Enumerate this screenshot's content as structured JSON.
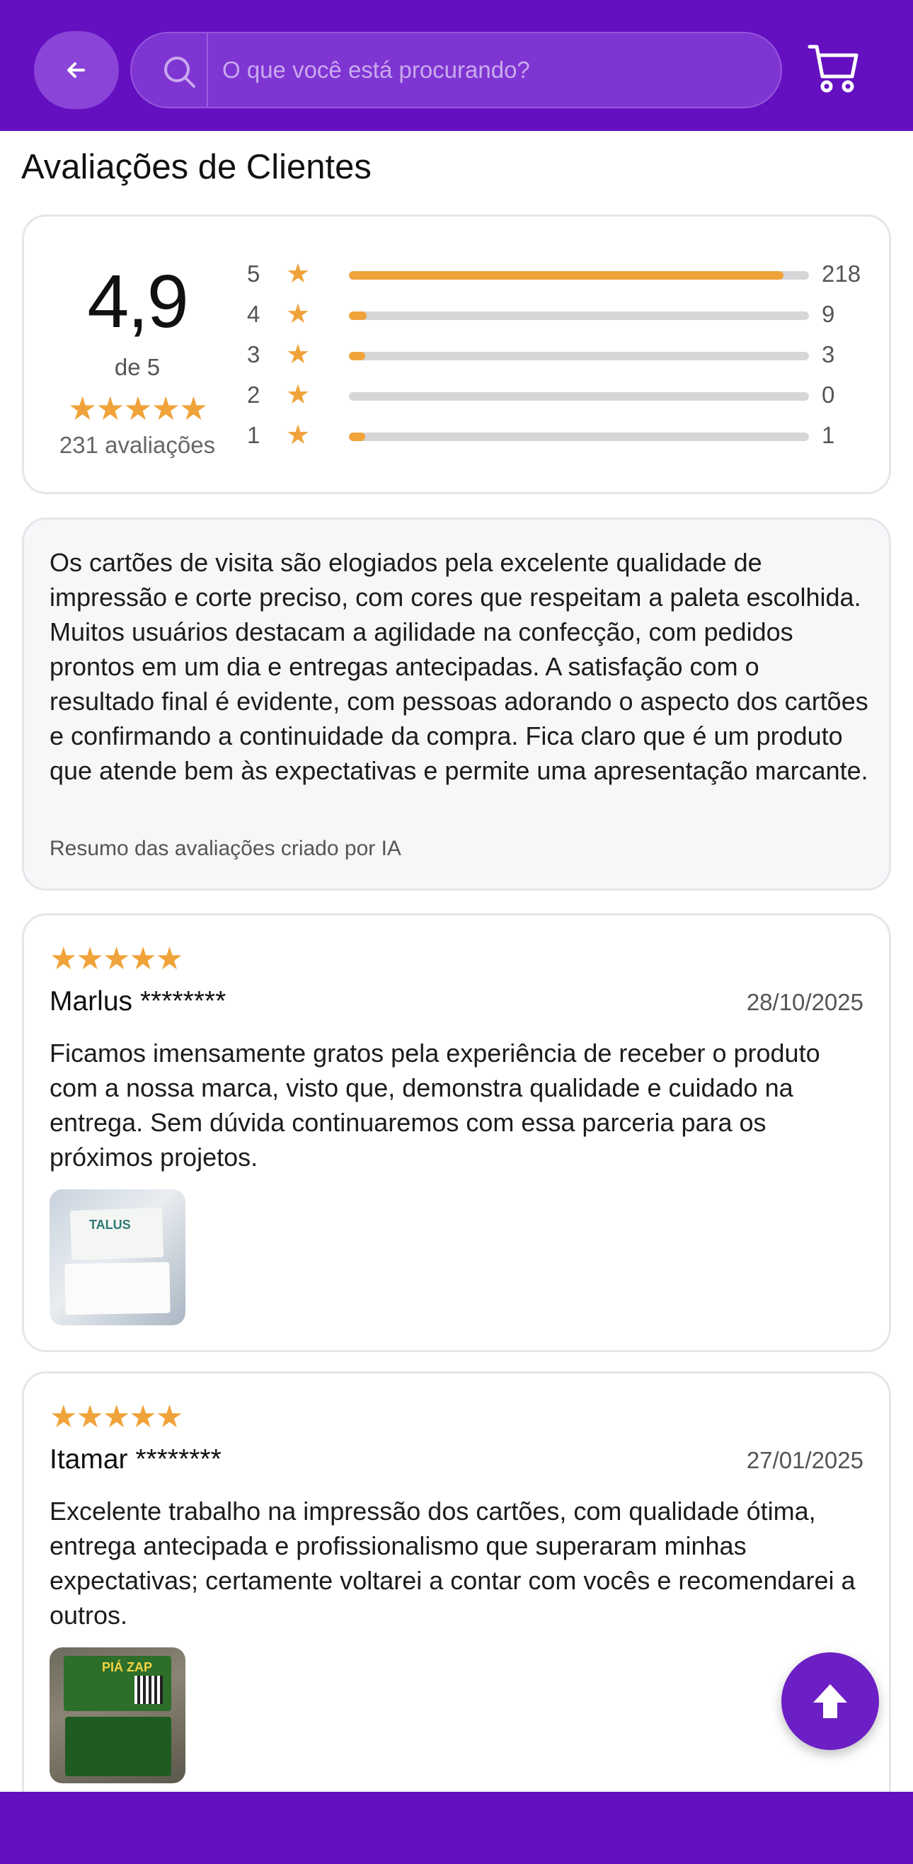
{
  "header": {
    "search_placeholder": "O que você está procurando?",
    "icons": {
      "back": "arrow-left-icon",
      "search": "search-icon",
      "cart": "cart-icon"
    },
    "colors": {
      "brand": "#6410c0",
      "star": "#f0a33a"
    }
  },
  "page_title": "Avaliações de Clientes",
  "rating_summary": {
    "score": "4,9",
    "out_of": "de 5",
    "stars": "★★★★★",
    "total": "231 avaliações",
    "breakdown": [
      {
        "stars": "5",
        "count": "218",
        "fraction": 0.944
      },
      {
        "stars": "4",
        "count": "9",
        "fraction": 0.039
      },
      {
        "stars": "3",
        "count": "3",
        "fraction": 0.013
      },
      {
        "stars": "2",
        "count": "0",
        "fraction": 0.0
      },
      {
        "stars": "1",
        "count": "1",
        "fraction": 0.004
      }
    ]
  },
  "ai_summary": {
    "text": "Os cartões de visita são elogiados pela excelente qualidade de impressão e corte preciso, com cores que respeitam a paleta escolhida. Muitos usuários destacam a agilidade na confecção, com pedidos prontos em um dia e entregas antecipadas. A satisfação com o resultado final é evidente, com pessoas adorando o aspecto dos cartões e confirmando a continuidade da compra. Fica claro que é um produto que atende bem às expectativas e permite uma apresentação marcante.",
    "note": "Resumo das avaliações criado por IA"
  },
  "reviews": [
    {
      "stars": "★★★★★",
      "rating": 5,
      "name": "Marlus ********",
      "date": "28/10/2025",
      "text": "Ficamos imensamente gratos pela experiência de receber o produto com a nossa marca, visto que, demonstra qualidade e cuidado na entrega. Sem dúvida continuaremos com essa parceria para os próximos projetos.",
      "photo_logo": "TALUS"
    },
    {
      "stars": "★★★★★",
      "rating": 5,
      "name": "Itamar ********",
      "date": "27/01/2025",
      "text": "Excelente trabalho na impressão dos cartões, com qualidade ótima, entrega antecipada e profissionalismo que superaram minhas expectativas; certamente voltarei a contar com vocês e recomendarei a outros.",
      "photo_logo": "PIÁ ZAP"
    }
  ],
  "scroll_top_icon": "arrow-up-icon"
}
